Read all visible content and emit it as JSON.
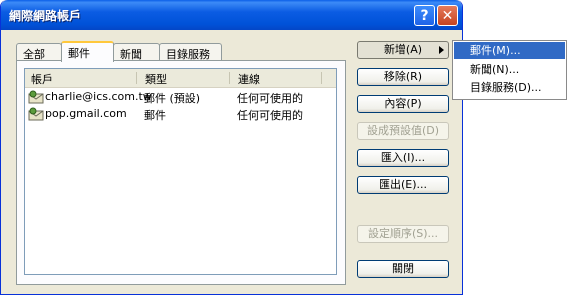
{
  "window": {
    "title": "網際網路帳戶",
    "help": "?",
    "close": "✕"
  },
  "tabs": [
    {
      "label": "全部"
    },
    {
      "label": "郵件"
    },
    {
      "label": "新聞"
    },
    {
      "label": "目錄服務"
    }
  ],
  "list": {
    "columns": [
      "帳戶",
      "類型",
      "連線"
    ],
    "rows": [
      {
        "account": "charlie@ics.com.tw",
        "type": "郵件 (預設)",
        "connection": "任何可使用的"
      },
      {
        "account": "pop.gmail.com",
        "type": "郵件",
        "connection": "任何可使用的"
      }
    ]
  },
  "buttons": {
    "add": "新增(A)",
    "remove": "移除(R)",
    "properties": "內容(P)",
    "set_default": "設成預設值(D)",
    "import": "匯入(I)...",
    "export": "匯出(E)...",
    "set_order": "設定順序(S)...",
    "close": "關閉"
  },
  "add_menu": [
    "郵件(M)...",
    "新聞(N)...",
    "目錄服務(D)..."
  ],
  "icons": {
    "account": "mail-account-icon",
    "submenu_arrow": "triangle-right-icon"
  },
  "colors": {
    "titlebar": "#0052d8",
    "face": "#ece9d8",
    "highlight": "#316ac5",
    "tab_accent": "#ffc83c"
  }
}
